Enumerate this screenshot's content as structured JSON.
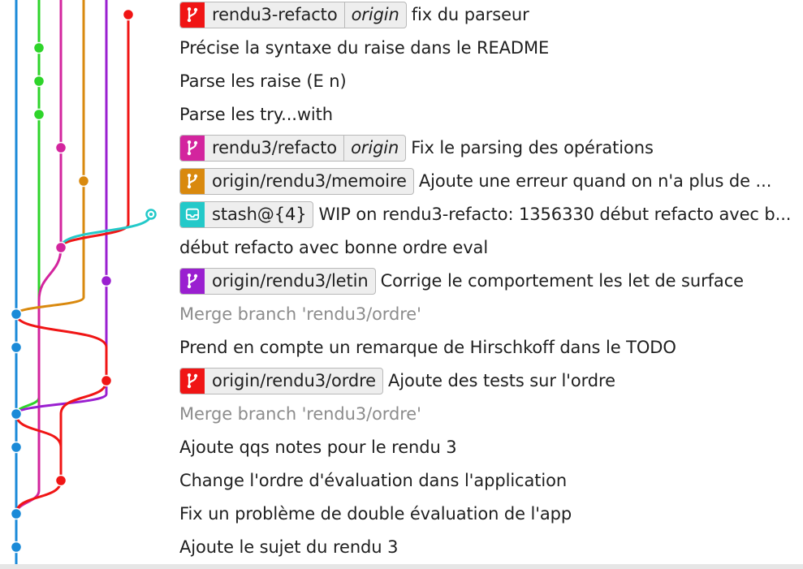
{
  "colors": {
    "blue": "#1a8ad8",
    "green": "#2ed42a",
    "magenta": "#d3259e",
    "orange": "#d9890e",
    "purple": "#9a1fd0",
    "red": "#f01515",
    "cyan": "#23c9c9"
  },
  "commits": [
    {
      "message": "fix du parseur",
      "ref": {
        "name": "rendu3-refacto",
        "remote": "origin",
        "color": "#f01515",
        "icon": "branch-icon"
      }
    },
    {
      "message": "Précise la syntaxe du raise dans le README"
    },
    {
      "message": "Parse les raise (E n)"
    },
    {
      "message": "Parse les try...with"
    },
    {
      "message": "Fix le parsing des opérations",
      "ref": {
        "name": "rendu3/refacto",
        "remote": "origin",
        "color": "#d3259e",
        "icon": "branch-icon"
      }
    },
    {
      "message": "Ajoute une erreur quand on n'a plus de ...",
      "ref": {
        "name": "origin/rendu3/memoire",
        "color": "#d9890e",
        "icon": "branch-icon"
      }
    },
    {
      "message": "WIP on rendu3-refacto: 1356330 début refacto avec b...",
      "ref": {
        "name": "stash@{4}",
        "color": "#23c9c9",
        "icon": "inbox-icon"
      }
    },
    {
      "message": "début refacto avec bonne ordre eval"
    },
    {
      "message": "Corrige le comportement les let de surface",
      "ref": {
        "name": "origin/rendu3/letin",
        "color": "#9a1fd0",
        "icon": "branch-icon"
      }
    },
    {
      "message": "Merge branch 'rendu3/ordre'",
      "muted": true
    },
    {
      "message": "Prend en compte un remarque de Hirschkoff dans le TODO"
    },
    {
      "message": "Ajoute des tests sur l'ordre",
      "ref": {
        "name": "origin/rendu3/ordre",
        "color": "#f01515",
        "icon": "branch-icon"
      }
    },
    {
      "message": "Merge branch 'rendu3/ordre'",
      "muted": true
    },
    {
      "message": "Ajoute qqs notes pour le rendu 3"
    },
    {
      "message": "Change l'ordre d'évaluation dans l'application"
    },
    {
      "message": "Fix un problème de double évaluation de l'app"
    },
    {
      "message": "Ajoute le sujet du rendu 3"
    }
  ]
}
